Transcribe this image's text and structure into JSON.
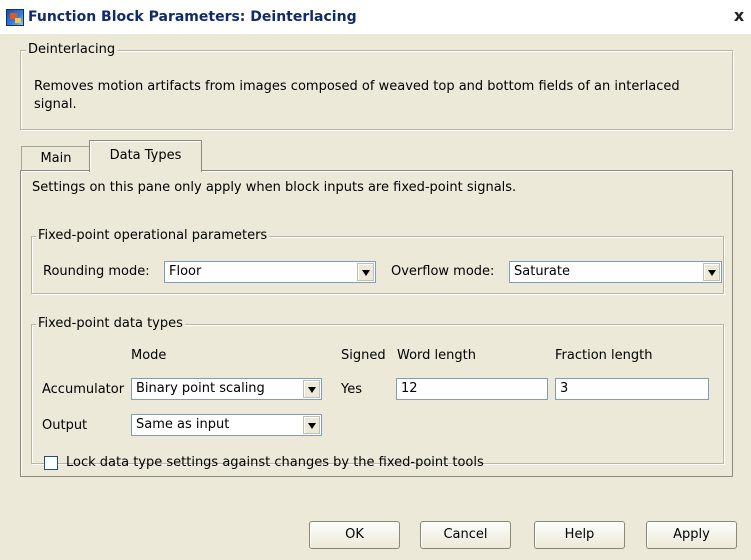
{
  "window": {
    "title": "Function Block Parameters: Deinterlacing",
    "close_glyph": "x"
  },
  "description": {
    "group_label": "Deinterlacing",
    "text": "Removes motion artifacts from images composed of weaved top and bottom fields of an interlaced signal."
  },
  "tabs": [
    {
      "label": "Main",
      "active": false
    },
    {
      "label": "Data Types",
      "active": true
    }
  ],
  "pane": {
    "note": "Settings on this pane only apply when block inputs are fixed-point signals."
  },
  "operational": {
    "group_label": "Fixed-point operational parameters",
    "rounding_label": "Rounding mode:",
    "rounding_value": "Floor",
    "overflow_label": "Overflow mode:",
    "overflow_value": "Saturate"
  },
  "datatypes": {
    "group_label": "Fixed-point data types",
    "headers": {
      "mode": "Mode",
      "signed": "Signed",
      "word_length": "Word length",
      "fraction_length": "Fraction length"
    },
    "rows": [
      {
        "label": "Accumulator",
        "mode": "Binary point scaling",
        "signed": "Yes",
        "word_length": "12",
        "fraction_length": "3"
      },
      {
        "label": "Output",
        "mode": "Same as input"
      }
    ],
    "lock_checkbox": {
      "label": "Lock data type settings against changes by the fixed-point tools",
      "checked": false
    }
  },
  "buttons": {
    "ok": "OK",
    "cancel": "Cancel",
    "help": "Help",
    "apply": "Apply"
  },
  "colors": {
    "title_text": "#0f2a6e",
    "dialog_bg": "#ece9d8",
    "field_border": "#7f9db9"
  }
}
